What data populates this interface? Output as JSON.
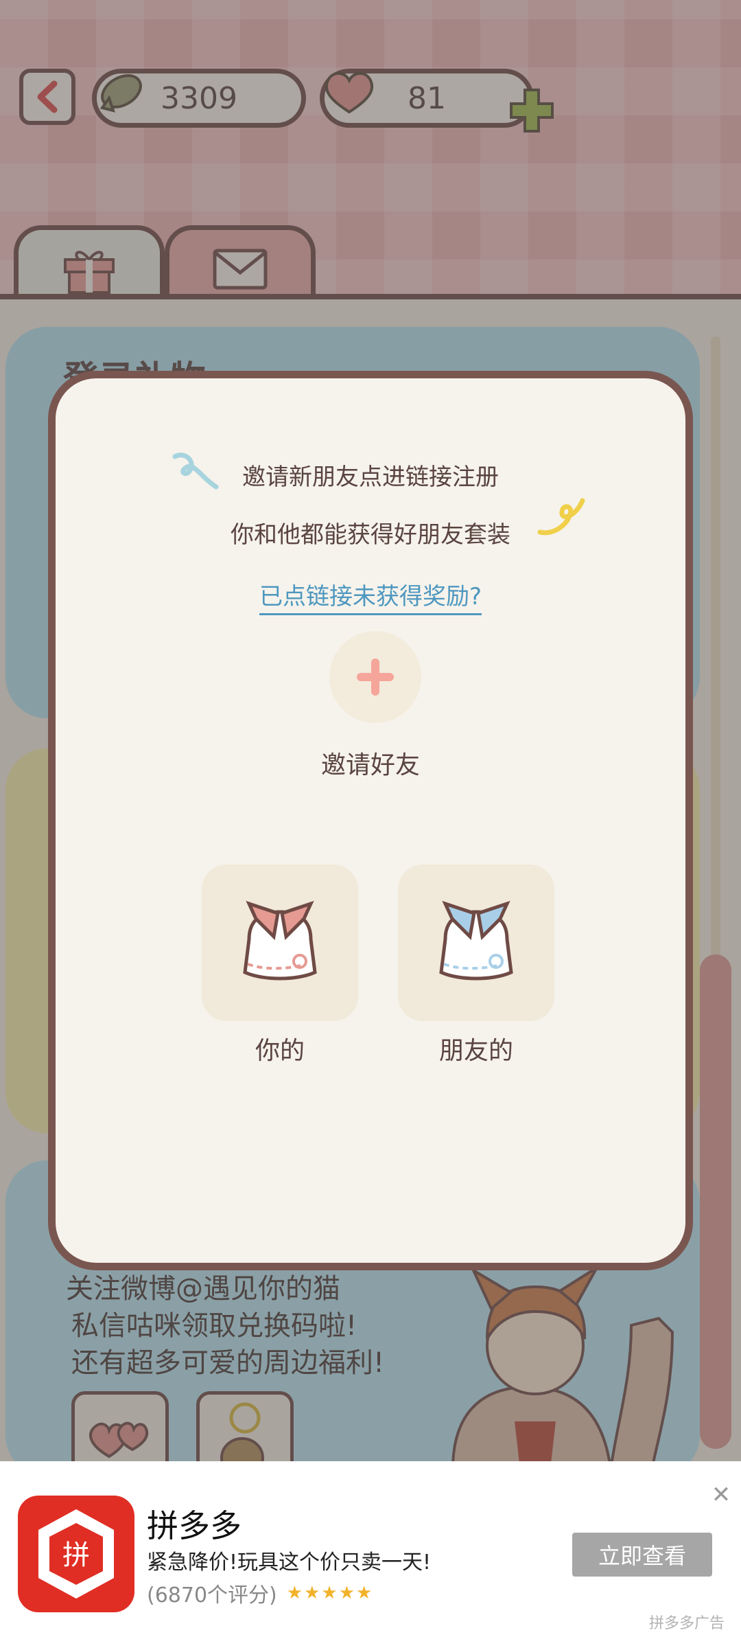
{
  "game": {
    "currency_fish": "3309",
    "currency_hearts": "81",
    "section_title": "登录礼物",
    "weibo_promo": [
      "关注微博@遇见你的猫",
      "私信咕咪领取兑换码啦!",
      "还有超多可爱的周边福利!"
    ]
  },
  "modal": {
    "line1": "邀请新朋友点进链接注册",
    "line2": "你和他都能获得好朋友套装",
    "help_link": "已点链接未获得奖励?",
    "invite_label": "邀请好友",
    "reward_yours": "你的",
    "reward_friend": "朋友的"
  },
  "ad": {
    "app_name": "拼多多",
    "logo_text": "拼",
    "description": "紧急降价!玩具这个价只卖一天!",
    "rating_text": "(6870个评分)",
    "stars": "★★★★★",
    "cta_label": "立即查看",
    "source_label": "拼多多广告"
  },
  "colors": {
    "accent_brown": "#7a5650",
    "link_blue": "#4e97bf",
    "ad_red": "#e02e24",
    "plus_pink": "#f5a59a"
  }
}
